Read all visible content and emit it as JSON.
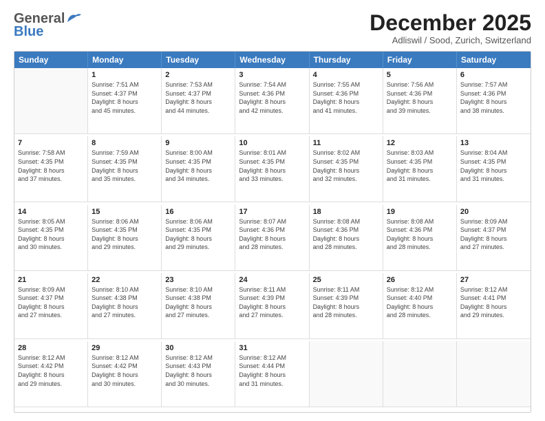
{
  "logo": {
    "line1": "General",
    "line2": "Blue"
  },
  "title": "December 2025",
  "subtitle": "Adliswil / Sood, Zurich, Switzerland",
  "days_of_week": [
    "Sunday",
    "Monday",
    "Tuesday",
    "Wednesday",
    "Thursday",
    "Friday",
    "Saturday"
  ],
  "weeks": [
    [
      {
        "day": "",
        "text": "",
        "empty": true
      },
      {
        "day": "1",
        "text": "Sunrise: 7:51 AM\nSunset: 4:37 PM\nDaylight: 8 hours\nand 45 minutes."
      },
      {
        "day": "2",
        "text": "Sunrise: 7:53 AM\nSunset: 4:37 PM\nDaylight: 8 hours\nand 44 minutes."
      },
      {
        "day": "3",
        "text": "Sunrise: 7:54 AM\nSunset: 4:36 PM\nDaylight: 8 hours\nand 42 minutes."
      },
      {
        "day": "4",
        "text": "Sunrise: 7:55 AM\nSunset: 4:36 PM\nDaylight: 8 hours\nand 41 minutes."
      },
      {
        "day": "5",
        "text": "Sunrise: 7:56 AM\nSunset: 4:36 PM\nDaylight: 8 hours\nand 39 minutes."
      },
      {
        "day": "6",
        "text": "Sunrise: 7:57 AM\nSunset: 4:36 PM\nDaylight: 8 hours\nand 38 minutes."
      }
    ],
    [
      {
        "day": "7",
        "text": "Sunrise: 7:58 AM\nSunset: 4:35 PM\nDaylight: 8 hours\nand 37 minutes."
      },
      {
        "day": "8",
        "text": "Sunrise: 7:59 AM\nSunset: 4:35 PM\nDaylight: 8 hours\nand 35 minutes."
      },
      {
        "day": "9",
        "text": "Sunrise: 8:00 AM\nSunset: 4:35 PM\nDaylight: 8 hours\nand 34 minutes."
      },
      {
        "day": "10",
        "text": "Sunrise: 8:01 AM\nSunset: 4:35 PM\nDaylight: 8 hours\nand 33 minutes."
      },
      {
        "day": "11",
        "text": "Sunrise: 8:02 AM\nSunset: 4:35 PM\nDaylight: 8 hours\nand 32 minutes."
      },
      {
        "day": "12",
        "text": "Sunrise: 8:03 AM\nSunset: 4:35 PM\nDaylight: 8 hours\nand 31 minutes."
      },
      {
        "day": "13",
        "text": "Sunrise: 8:04 AM\nSunset: 4:35 PM\nDaylight: 8 hours\nand 31 minutes."
      }
    ],
    [
      {
        "day": "14",
        "text": "Sunrise: 8:05 AM\nSunset: 4:35 PM\nDaylight: 8 hours\nand 30 minutes."
      },
      {
        "day": "15",
        "text": "Sunrise: 8:06 AM\nSunset: 4:35 PM\nDaylight: 8 hours\nand 29 minutes."
      },
      {
        "day": "16",
        "text": "Sunrise: 8:06 AM\nSunset: 4:35 PM\nDaylight: 8 hours\nand 29 minutes."
      },
      {
        "day": "17",
        "text": "Sunrise: 8:07 AM\nSunset: 4:36 PM\nDaylight: 8 hours\nand 28 minutes."
      },
      {
        "day": "18",
        "text": "Sunrise: 8:08 AM\nSunset: 4:36 PM\nDaylight: 8 hours\nand 28 minutes."
      },
      {
        "day": "19",
        "text": "Sunrise: 8:08 AM\nSunset: 4:36 PM\nDaylight: 8 hours\nand 28 minutes."
      },
      {
        "day": "20",
        "text": "Sunrise: 8:09 AM\nSunset: 4:37 PM\nDaylight: 8 hours\nand 27 minutes."
      }
    ],
    [
      {
        "day": "21",
        "text": "Sunrise: 8:09 AM\nSunset: 4:37 PM\nDaylight: 8 hours\nand 27 minutes."
      },
      {
        "day": "22",
        "text": "Sunrise: 8:10 AM\nSunset: 4:38 PM\nDaylight: 8 hours\nand 27 minutes."
      },
      {
        "day": "23",
        "text": "Sunrise: 8:10 AM\nSunset: 4:38 PM\nDaylight: 8 hours\nand 27 minutes."
      },
      {
        "day": "24",
        "text": "Sunrise: 8:11 AM\nSunset: 4:39 PM\nDaylight: 8 hours\nand 27 minutes."
      },
      {
        "day": "25",
        "text": "Sunrise: 8:11 AM\nSunset: 4:39 PM\nDaylight: 8 hours\nand 28 minutes."
      },
      {
        "day": "26",
        "text": "Sunrise: 8:12 AM\nSunset: 4:40 PM\nDaylight: 8 hours\nand 28 minutes."
      },
      {
        "day": "27",
        "text": "Sunrise: 8:12 AM\nSunset: 4:41 PM\nDaylight: 8 hours\nand 29 minutes."
      }
    ],
    [
      {
        "day": "28",
        "text": "Sunrise: 8:12 AM\nSunset: 4:42 PM\nDaylight: 8 hours\nand 29 minutes."
      },
      {
        "day": "29",
        "text": "Sunrise: 8:12 AM\nSunset: 4:42 PM\nDaylight: 8 hours\nand 30 minutes."
      },
      {
        "day": "30",
        "text": "Sunrise: 8:12 AM\nSunset: 4:43 PM\nDaylight: 8 hours\nand 30 minutes."
      },
      {
        "day": "31",
        "text": "Sunrise: 8:12 AM\nSunset: 4:44 PM\nDaylight: 8 hours\nand 31 minutes."
      },
      {
        "day": "",
        "text": "",
        "empty": true
      },
      {
        "day": "",
        "text": "",
        "empty": true
      },
      {
        "day": "",
        "text": "",
        "empty": true
      }
    ]
  ]
}
